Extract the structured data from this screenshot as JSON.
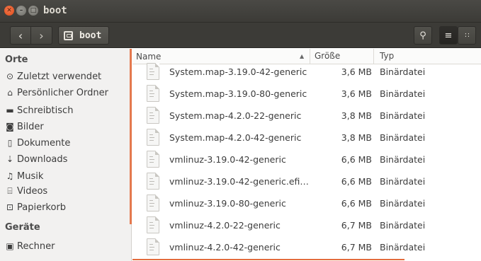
{
  "window": {
    "title": "boot",
    "close_glyph": "✕",
    "min_glyph": "–",
    "max_glyph": "□"
  },
  "toolbar": {
    "back_glyph": "‹",
    "forward_glyph": "›",
    "path_label": "boot",
    "search_glyph": "⚲",
    "list_view_glyph": "≡",
    "grid_view_glyph": "∷"
  },
  "sidebar": {
    "places_heading": "Orte",
    "places": [
      {
        "label": "Zuletzt verwendet",
        "icon": "clock-icon",
        "glyph": "⊙"
      },
      {
        "label": "Persönlicher Ordner",
        "icon": "home-icon",
        "glyph": "⌂"
      },
      {
        "label": "Schreibtisch",
        "icon": "desktop-folder-icon",
        "glyph": "▬"
      },
      {
        "label": "Bilder",
        "icon": "camera-icon",
        "glyph": "◙"
      },
      {
        "label": "Dokumente",
        "icon": "document-icon",
        "glyph": "▯"
      },
      {
        "label": "Downloads",
        "icon": "download-icon",
        "glyph": "⇣"
      },
      {
        "label": "Musik",
        "icon": "music-icon",
        "glyph": "♫"
      },
      {
        "label": "Videos",
        "icon": "video-icon",
        "glyph": "⌸"
      },
      {
        "label": "Papierkorb",
        "icon": "trash-icon",
        "glyph": "⊡"
      }
    ],
    "devices_heading": "Geräte",
    "devices": [
      {
        "label": "Rechner",
        "icon": "computer-icon",
        "glyph": "▣"
      }
    ]
  },
  "filelist": {
    "columns": {
      "name": "Name",
      "size": "Größe",
      "type": "Typ",
      "sort_glyph": "▲"
    },
    "rows": [
      {
        "name": "System.map-3.19.0-42-generic",
        "size": "3,6 MB",
        "type": "Binärdatei"
      },
      {
        "name": "System.map-3.19.0-80-generic",
        "size": "3,6 MB",
        "type": "Binärdatei"
      },
      {
        "name": "System.map-4.2.0-22-generic",
        "size": "3,8 MB",
        "type": "Binärdatei"
      },
      {
        "name": "System.map-4.2.0-42-generic",
        "size": "3,8 MB",
        "type": "Binärdatei"
      },
      {
        "name": "vmlinuz-3.19.0-42-generic",
        "size": "6,6 MB",
        "type": "Binärdatei"
      },
      {
        "name": "vmlinuz-3.19.0-42-generic.efi…",
        "size": "6,6 MB",
        "type": "Binärdatei"
      },
      {
        "name": "vmlinuz-3.19.0-80-generic",
        "size": "6,6 MB",
        "type": "Binärdatei"
      },
      {
        "name": "vmlinuz-4.2.0-22-generic",
        "size": "6,7 MB",
        "type": "Binärdatei"
      },
      {
        "name": "vmlinuz-4.2.0-42-generic",
        "size": "6,7 MB",
        "type": "Binärdatei"
      }
    ]
  },
  "colors": {
    "accent": "#e36c3d",
    "titlebar": "#3c3b37",
    "sidebar_bg": "#f2f1f0"
  }
}
